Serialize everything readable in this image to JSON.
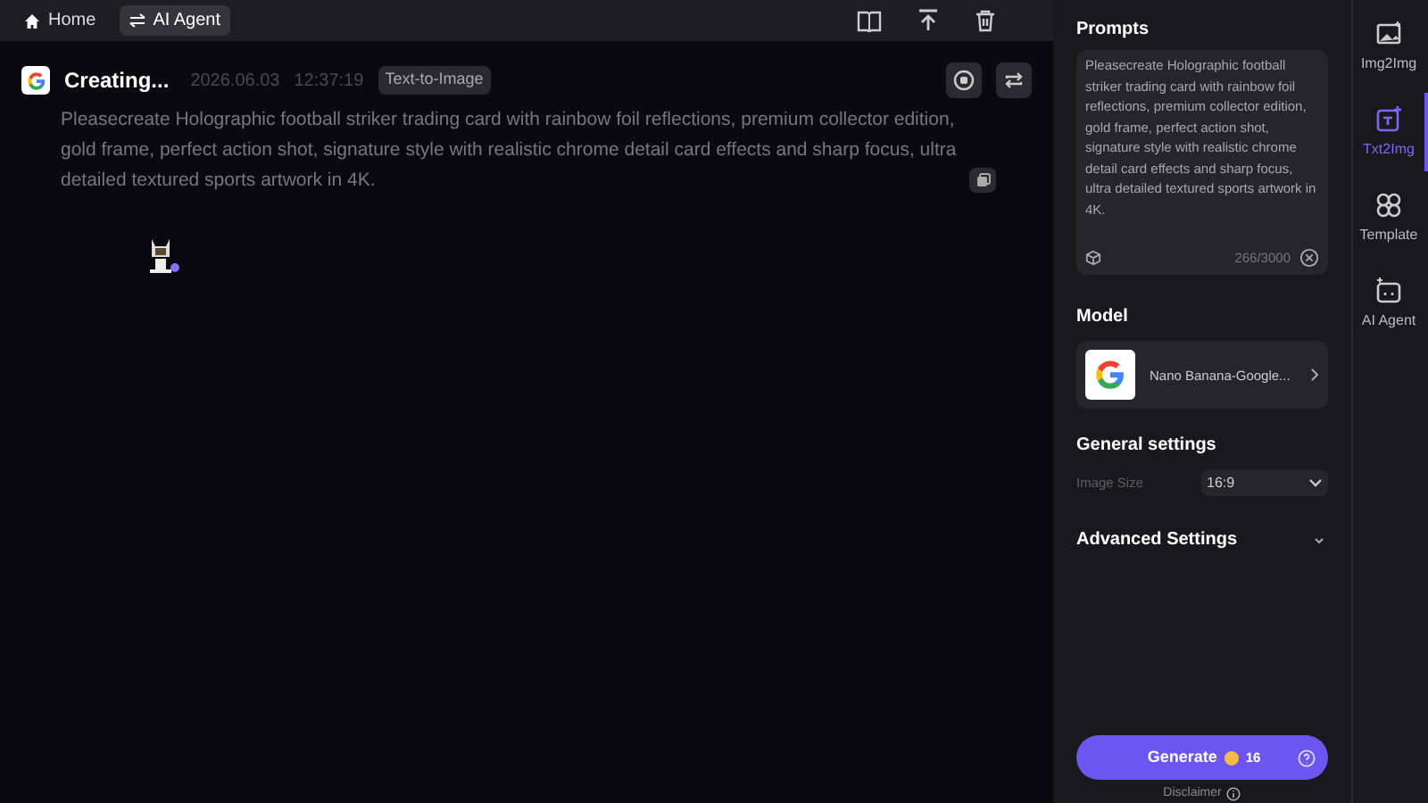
{
  "topbar": {
    "tabs": [
      {
        "label": "Home",
        "kind": "home",
        "selected": false
      },
      {
        "label": "AI Agent",
        "kind": "agent",
        "selected": true
      }
    ]
  },
  "task": {
    "title": "Creating...",
    "date": "2026.06.03",
    "time": "12:37:19",
    "tag": "Text-to-Image",
    "prompt": "Pleasecreate Holographic football striker trading card with rainbow foil reflections, premium collector edition, gold frame, perfect action shot, signature style with realistic chrome detail card effects and sharp focus, ultra detailed textured sports artwork in 4K."
  },
  "panel": {
    "prompts_title": "Prompts",
    "prompt_value": "Pleasecreate Holographic football striker trading card with rainbow foil reflections, premium collector edition, gold frame, perfect action shot, signature style with realistic chrome detail card effects and sharp focus, ultra detailed textured sports artwork in 4K.",
    "counter": "266/3000",
    "model_title": "Model",
    "model_name": "Nano Banana-Google...",
    "general_title": "General settings",
    "image_size_label": "Image Size",
    "image_size_value": "16:9",
    "advanced_title": "Advanced Settings",
    "generate_label": "Generate",
    "credits": "16",
    "disclaimer": "Disclaimer"
  },
  "sidenav": [
    {
      "label": "Img2Img",
      "kind": "img",
      "selected": false
    },
    {
      "label": "Txt2Img",
      "kind": "txt",
      "selected": true
    },
    {
      "label": "Template",
      "kind": "template",
      "selected": false
    },
    {
      "label": "AI Agent",
      "kind": "agent",
      "selected": false
    }
  ]
}
